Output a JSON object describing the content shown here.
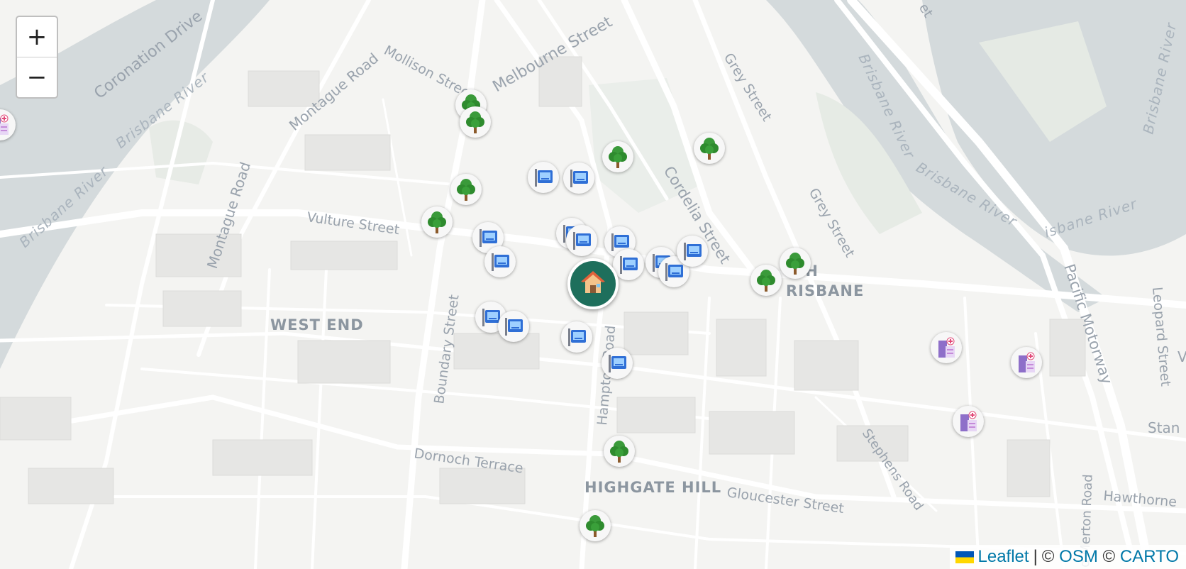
{
  "map": {
    "zoom_in_label": "+",
    "zoom_out_label": "−",
    "attribution": {
      "leaflet": "Leaflet",
      "separator": "|",
      "copy1": "©",
      "osm": "OSM",
      "copy2": "©",
      "carto": "CARTO"
    },
    "labels": {
      "coronation_drive": "Coronation Drive",
      "brisbane_river_1": "Brisbane River",
      "brisbane_river_2": "Brisbane River",
      "brisbane_river_3": "Brisbane River",
      "brisbane_river_4": "Brisbane River",
      "brisbane_river_5": "Brisbane River",
      "brisbane_river_6": "isbane River",
      "brisbane_river_7": "Brisbane River",
      "montague_road_1": "Montague Road",
      "montague_road_2": "Montague Road",
      "mollison_street": "Mollison Street",
      "melbourne_street": "Melbourne Street",
      "grey_street_1": "Grey Street",
      "grey_street_2": "Grey Street",
      "cordelia_street": "Cordelia Street",
      "vulture_street": "Vulture Street",
      "boundary_street": "Boundary Street",
      "hampton_road": "Hampton Road",
      "dornoch_terrace": "Dornoch Terrace",
      "gloucester_street": "Gloucester Street",
      "stephens_road": "Stephens Road",
      "merton_road": "d Merton Road",
      "pacific_motorway": "Pacific Motorway",
      "leopard_street": "Leopard Street",
      "hawthorne": "Hawthorne",
      "stanley": "Stan",
      "west_end": "WEST END",
      "highgate_hill": "HIGHGATE HILL",
      "south_brisbane_1": "TH",
      "south_brisbane_2": "RISBANE",
      "street_tr": "et",
      "v_edge": "V"
    }
  },
  "markers": {
    "home": {
      "icon": "house-icon",
      "color": "#1e6f5c"
    },
    "parks": [
      {
        "icon": "tree-icon"
      },
      {
        "icon": "tree-icon"
      },
      {
        "icon": "tree-icon"
      },
      {
        "icon": "tree-icon"
      },
      {
        "icon": "tree-icon"
      },
      {
        "icon": "tree-icon"
      },
      {
        "icon": "tree-icon"
      },
      {
        "icon": "tree-icon"
      },
      {
        "icon": "tree-icon"
      },
      {
        "icon": "tree-icon"
      },
      {
        "icon": "tree-icon"
      }
    ],
    "schools": [
      {
        "icon": "school-board-icon"
      },
      {
        "icon": "school-board-icon"
      },
      {
        "icon": "school-board-icon"
      },
      {
        "icon": "school-board-icon"
      },
      {
        "icon": "school-board-icon"
      },
      {
        "icon": "school-board-icon"
      },
      {
        "icon": "school-board-icon"
      },
      {
        "icon": "school-board-icon"
      },
      {
        "icon": "school-board-icon"
      },
      {
        "icon": "school-board-icon"
      },
      {
        "icon": "school-board-icon"
      },
      {
        "icon": "school-board-icon"
      },
      {
        "icon": "school-board-icon"
      },
      {
        "icon": "school-board-icon"
      },
      {
        "icon": "school-board-icon"
      },
      {
        "icon": "school-board-icon"
      }
    ],
    "hospitals": [
      {
        "icon": "hospital-icon"
      },
      {
        "icon": "hospital-icon"
      },
      {
        "icon": "hospital-icon"
      },
      {
        "icon": "hospital-icon"
      }
    ]
  }
}
